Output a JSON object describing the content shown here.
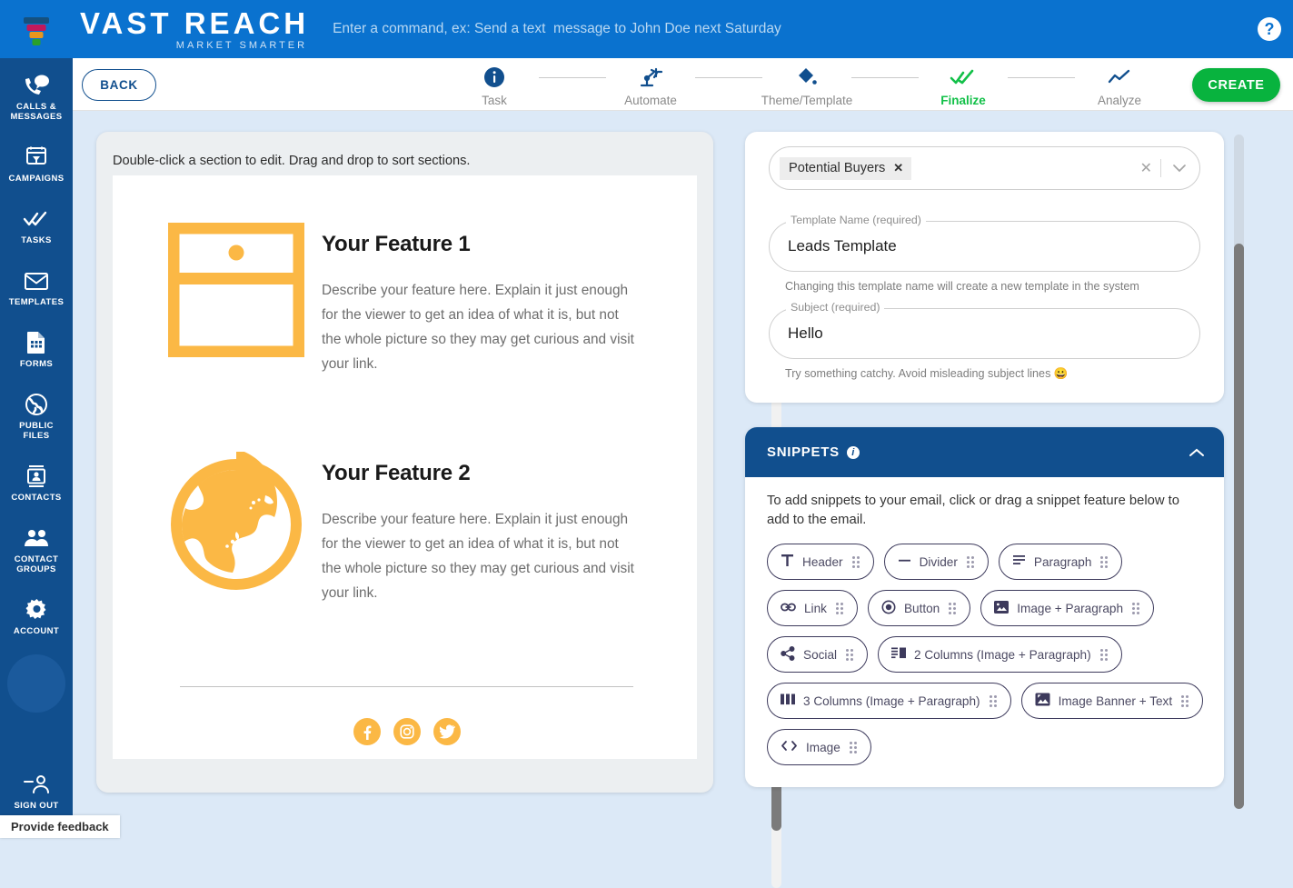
{
  "topbar": {
    "brand_main": "VAST REACH",
    "brand_sub": "MARKET SMARTER",
    "command_hint": "Enter a command, ex: Send a text  message to John Doe next Saturday",
    "help_label": "?",
    "bg_color": "#0a72cf"
  },
  "sidebar": {
    "bg_color": "#114f8e",
    "items": [
      {
        "label": "CALLS &\nMESSAGES",
        "icon": "calls-messages-icon"
      },
      {
        "label": "CAMPAIGNS",
        "icon": "campaigns-icon"
      },
      {
        "label": "TASKS",
        "icon": "tasks-icon"
      },
      {
        "label": "TEMPLATES",
        "icon": "templates-icon"
      },
      {
        "label": "FORMS",
        "icon": "forms-icon"
      },
      {
        "label": "PUBLIC\nFILES",
        "icon": "public-files-icon"
      },
      {
        "label": "CONTACTS",
        "icon": "contacts-icon"
      },
      {
        "label": "CONTACT\nGROUPS",
        "icon": "contact-groups-icon"
      },
      {
        "label": "ACCOUNT",
        "icon": "account-icon"
      }
    ],
    "signout": {
      "label": "SIGN OUT",
      "icon": "sign-out-icon"
    }
  },
  "stepbar": {
    "back_label": "BACK",
    "create_label": "CREATE",
    "active_color": "#12c048",
    "steps": [
      {
        "label": "Task",
        "icon": "info-icon",
        "state": "done"
      },
      {
        "label": "Automate",
        "icon": "robot-arm-icon",
        "state": "done"
      },
      {
        "label": "Theme/Template",
        "icon": "paint-bucket-icon",
        "state": "done"
      },
      {
        "label": "Finalize",
        "icon": "double-check-icon",
        "state": "active"
      },
      {
        "label": "Analyze",
        "icon": "line-chart-icon",
        "state": "upcoming"
      }
    ]
  },
  "preview": {
    "hint": "Double-click a section to edit. Drag and drop to sort sections.",
    "accent_color": "#fbb845",
    "sections": [
      {
        "icon": "drawer-icon",
        "title": "Your Feature 1",
        "text": "Describe your feature here. Explain it just enough for the viewer to get an idea of what it is, but not the whole picture so they may get curious and visit your link."
      },
      {
        "icon": "globe-icon",
        "title": "Your Feature 2",
        "text": "Describe your feature here. Explain it just enough for the viewer to get an idea of what it is, but not the whole picture so they may get curious and visit your link."
      }
    ],
    "social": [
      {
        "name": "facebook-icon"
      },
      {
        "name": "instagram-icon"
      },
      {
        "name": "twitter-icon"
      }
    ]
  },
  "details": {
    "audience": {
      "chip_label": "Potential Buyers",
      "chip_remove": "✕",
      "clear_icon": "clear-icon",
      "caret_icon": "chevron-down-icon"
    },
    "template_name": {
      "legend": "Template Name (required)",
      "value": "Leads Template",
      "placeholder": "Template Name",
      "helper": "Changing this template name will create a new template in the system"
    },
    "subject": {
      "legend": "Subject (required)",
      "value": "Hello",
      "placeholder": "Subject",
      "helper": "Try something catchy. Avoid misleading subject lines 😀"
    }
  },
  "snippets": {
    "title": "SNIPPETS",
    "header_color": "#114f8e",
    "description": "To add snippets to your email, click or drag a snippet feature below to add to the email.",
    "collapse_icon": "chevron-up-icon",
    "items": [
      {
        "label": "Header",
        "icon": "text-t-icon"
      },
      {
        "label": "Divider",
        "icon": "divider-icon"
      },
      {
        "label": "Paragraph",
        "icon": "paragraph-icon"
      },
      {
        "label": "Link",
        "icon": "link-icon"
      },
      {
        "label": "Button",
        "icon": "button-radio-icon"
      },
      {
        "label": "Image + Paragraph",
        "icon": "image-icon"
      },
      {
        "label": "Social",
        "icon": "share-icon"
      },
      {
        "label": "2 Columns (Image + Paragraph)",
        "icon": "two-columns-icon"
      },
      {
        "label": "3 Columns (Image + Paragraph)",
        "icon": "three-columns-icon"
      },
      {
        "label": "Image Banner + Text",
        "icon": "image-banner-icon"
      },
      {
        "label": "Image",
        "icon": "code-brackets-icon"
      }
    ]
  },
  "feedback": {
    "label": "Provide feedback"
  }
}
